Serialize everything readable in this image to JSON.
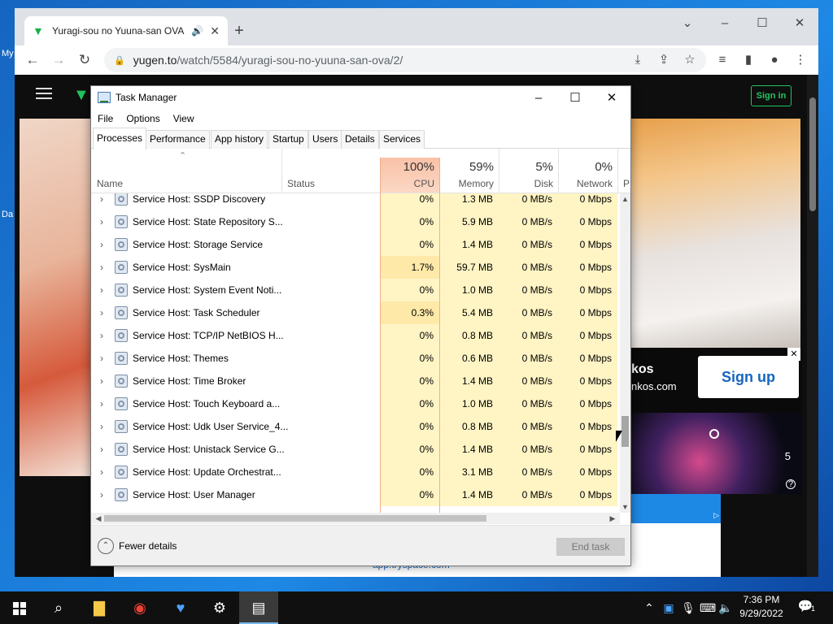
{
  "desktop": {
    "labels": [
      "My",
      "Da"
    ]
  },
  "browser": {
    "tab_title": "Yuragi-sou no Yuuna-san OVA",
    "url_host": "yugen.to",
    "url_path": "/watch/5584/yuragi-sou-no-yuuna-san-ova/2/"
  },
  "site": {
    "signin": "Sign in",
    "ad_brand": "kos",
    "ad_url": "nkos.com",
    "ad_signup": "Sign up",
    "ad_number": "5",
    "ad_footer_url": "app.tryspace.com"
  },
  "taskmanager": {
    "title": "Task Manager",
    "menu": [
      "File",
      "Options",
      "View"
    ],
    "tabs": [
      "Processes",
      "Performance",
      "App history",
      "Startup",
      "Users",
      "Details",
      "Services"
    ],
    "active_tab": "Processes",
    "columns": {
      "name": "Name",
      "status": "Status",
      "cpu": {
        "pct": "100%",
        "label": "CPU"
      },
      "memory": {
        "pct": "59%",
        "label": "Memory"
      },
      "disk": {
        "pct": "5%",
        "label": "Disk"
      },
      "network": {
        "pct": "0%",
        "label": "Network"
      },
      "power_initial": "P"
    },
    "rows": [
      {
        "name": "Service Host: SSDP Discovery",
        "cpu": "0%",
        "memory": "1.3 MB",
        "disk": "0 MB/s",
        "network": "0 Mbps"
      },
      {
        "name": "Service Host: State Repository S...",
        "cpu": "0%",
        "memory": "5.9 MB",
        "disk": "0 MB/s",
        "network": "0 Mbps"
      },
      {
        "name": "Service Host: Storage Service",
        "cpu": "0%",
        "memory": "1.4 MB",
        "disk": "0 MB/s",
        "network": "0 Mbps"
      },
      {
        "name": "Service Host: SysMain",
        "cpu": "1.7%",
        "memory": "59.7 MB",
        "disk": "0 MB/s",
        "network": "0 Mbps"
      },
      {
        "name": "Service Host: System Event Noti...",
        "cpu": "0%",
        "memory": "1.0 MB",
        "disk": "0 MB/s",
        "network": "0 Mbps"
      },
      {
        "name": "Service Host: Task Scheduler",
        "cpu": "0.3%",
        "memory": "5.4 MB",
        "disk": "0 MB/s",
        "network": "0 Mbps"
      },
      {
        "name": "Service Host: TCP/IP NetBIOS H...",
        "cpu": "0%",
        "memory": "0.8 MB",
        "disk": "0 MB/s",
        "network": "0 Mbps"
      },
      {
        "name": "Service Host: Themes",
        "cpu": "0%",
        "memory": "0.6 MB",
        "disk": "0 MB/s",
        "network": "0 Mbps"
      },
      {
        "name": "Service Host: Time Broker",
        "cpu": "0%",
        "memory": "1.4 MB",
        "disk": "0 MB/s",
        "network": "0 Mbps"
      },
      {
        "name": "Service Host: Touch Keyboard a...",
        "cpu": "0%",
        "memory": "1.0 MB",
        "disk": "0 MB/s",
        "network": "0 Mbps"
      },
      {
        "name": "Service Host: Udk User Service_4...",
        "cpu": "0%",
        "memory": "0.8 MB",
        "disk": "0 MB/s",
        "network": "0 Mbps"
      },
      {
        "name": "Service Host: Unistack Service G...",
        "cpu": "0%",
        "memory": "1.4 MB",
        "disk": "0 MB/s",
        "network": "0 Mbps"
      },
      {
        "name": "Service Host: Update Orchestrat...",
        "cpu": "0%",
        "memory": "3.1 MB",
        "disk": "0 MB/s",
        "network": "0 Mbps"
      },
      {
        "name": "Service Host: User Manager",
        "cpu": "0%",
        "memory": "1.4 MB",
        "disk": "0 MB/s",
        "network": "0 Mbps"
      }
    ],
    "fewer_details": "Fewer details",
    "end_task": "End task"
  },
  "taskbar": {
    "time": "7:36 PM",
    "date": "9/29/2022",
    "notification_count": "1"
  },
  "colors": {
    "cpu_header": "#f9c1a7",
    "cell_bg": "#fff4c4",
    "accent_green": "#21c55d"
  }
}
